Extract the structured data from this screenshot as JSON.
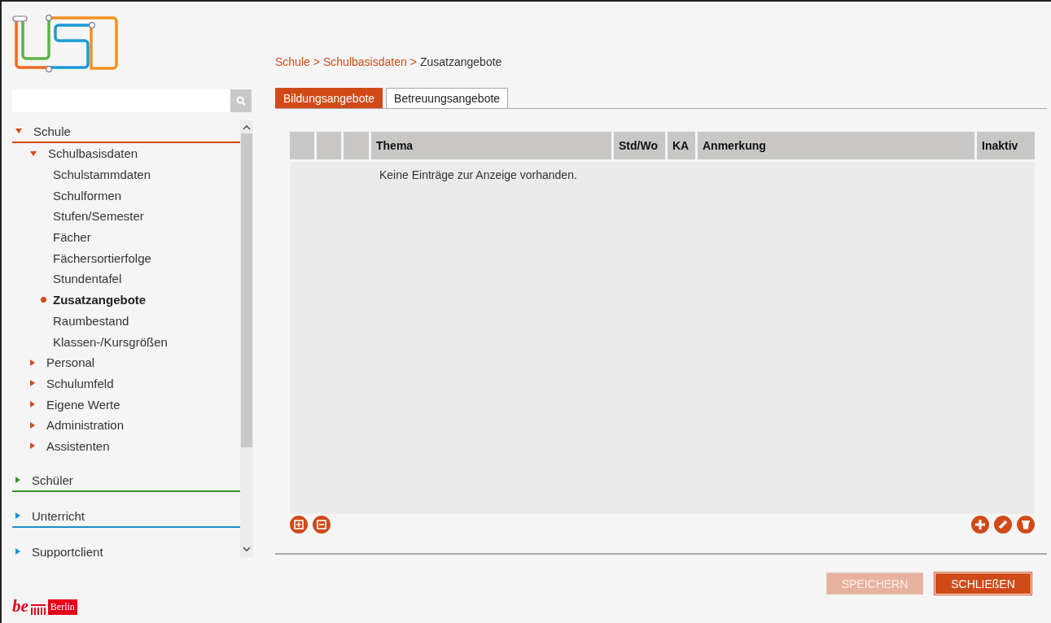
{
  "nav": [
    {
      "label": "Schule",
      "color": "#d24a1a",
      "expanded": true,
      "children": [
        {
          "label": "Schulbasisdaten",
          "expanded": true,
          "selected": false,
          "children": [
            {
              "label": "Schulstammdaten",
              "selected": false
            },
            {
              "label": "Schulformen",
              "selected": false
            },
            {
              "label": "Stufen/Semester",
              "selected": false
            },
            {
              "label": "Fächer",
              "selected": false
            },
            {
              "label": "Fächersortierfolge",
              "selected": false
            },
            {
              "label": "Stundentafel",
              "selected": false
            },
            {
              "label": "Zusatzangebote",
              "selected": true
            },
            {
              "label": "Raumbestand",
              "selected": false
            },
            {
              "label": "Klassen-/Kursgrößen",
              "selected": false
            }
          ]
        },
        {
          "label": "Personal",
          "expanded": false,
          "selected": false
        },
        {
          "label": "Schulumfeld",
          "expanded": false,
          "selected": false
        },
        {
          "label": "Eigene Werte",
          "expanded": false,
          "selected": false
        },
        {
          "label": "Administration",
          "expanded": false,
          "selected": false
        },
        {
          "label": "Assistenten",
          "expanded": false,
          "selected": false
        }
      ]
    },
    {
      "label": "Schüler",
      "color": "#3a8f2e",
      "expanded": false
    },
    {
      "label": "Unterricht",
      "color": "#1a8fc4",
      "expanded": false
    },
    {
      "label": "Supportclient",
      "color": "#1a8fc4",
      "expanded": false
    }
  ],
  "brand": {
    "mark": "be",
    "label": "Berlin"
  },
  "breadcrumb": {
    "separator": ">",
    "items": [
      "Schule",
      "Schulbasisdaten",
      "Zusatzangebote"
    ]
  },
  "tabs": [
    {
      "label": "Bildungsangebote",
      "selected": true
    },
    {
      "label": "Betreuungsangebote",
      "selected": false
    }
  ],
  "table": {
    "columns": [
      "Thema",
      "Std/Wo",
      "KA",
      "Anmerkung",
      "Inaktiv"
    ],
    "empty_message": "Keine Einträge zur Anzeige vorhanden."
  },
  "buttons": [
    {
      "label": "SPEICHERN",
      "disabled": true
    },
    {
      "label": "SCHLIEßEN",
      "disabled": false
    }
  ]
}
